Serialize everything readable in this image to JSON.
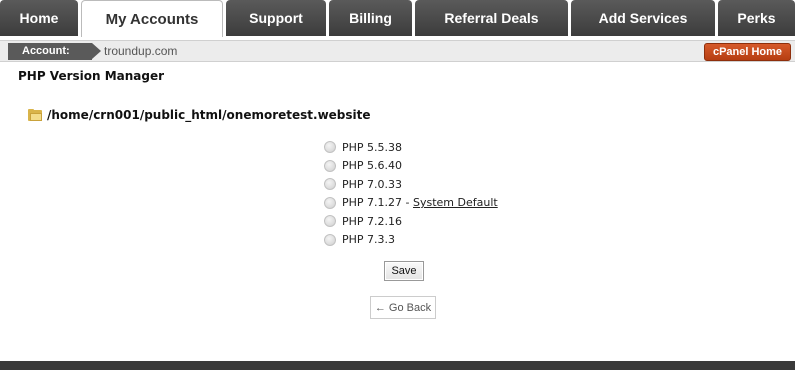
{
  "tabs": [
    {
      "label": "Home",
      "active": false
    },
    {
      "label": "My Accounts",
      "active": true
    },
    {
      "label": "Support",
      "active": false
    },
    {
      "label": "Billing",
      "active": false
    },
    {
      "label": "Referral Deals",
      "active": false
    },
    {
      "label": "Add Services",
      "active": false
    },
    {
      "label": "Perks",
      "active": false
    }
  ],
  "account": {
    "label": "Account:",
    "domain": "troundup.com",
    "cpanel_button": "cPanel Home"
  },
  "page": {
    "title": "PHP Version Manager",
    "path": "/home/crn001/public_html/onemoretest.website"
  },
  "php_versions": [
    {
      "label": "PHP 5.5.38",
      "selected": false
    },
    {
      "label": "PHP 5.6.40",
      "selected": false
    },
    {
      "label": "PHP 7.0.33",
      "selected": false
    },
    {
      "label": "PHP 7.1.27",
      "suffix": " - ",
      "note": "System Default",
      "selected": false
    },
    {
      "label": "PHP 7.2.16",
      "selected": false
    },
    {
      "label": "PHP 7.3.3",
      "selected": false
    }
  ],
  "actions": {
    "save_label": "Save",
    "go_back_label": "← Go Back"
  },
  "colors": {
    "tab_bg": "#4a4a4a",
    "cpanel_orange": "#c24a1a",
    "footer": "#3a3a3a"
  }
}
